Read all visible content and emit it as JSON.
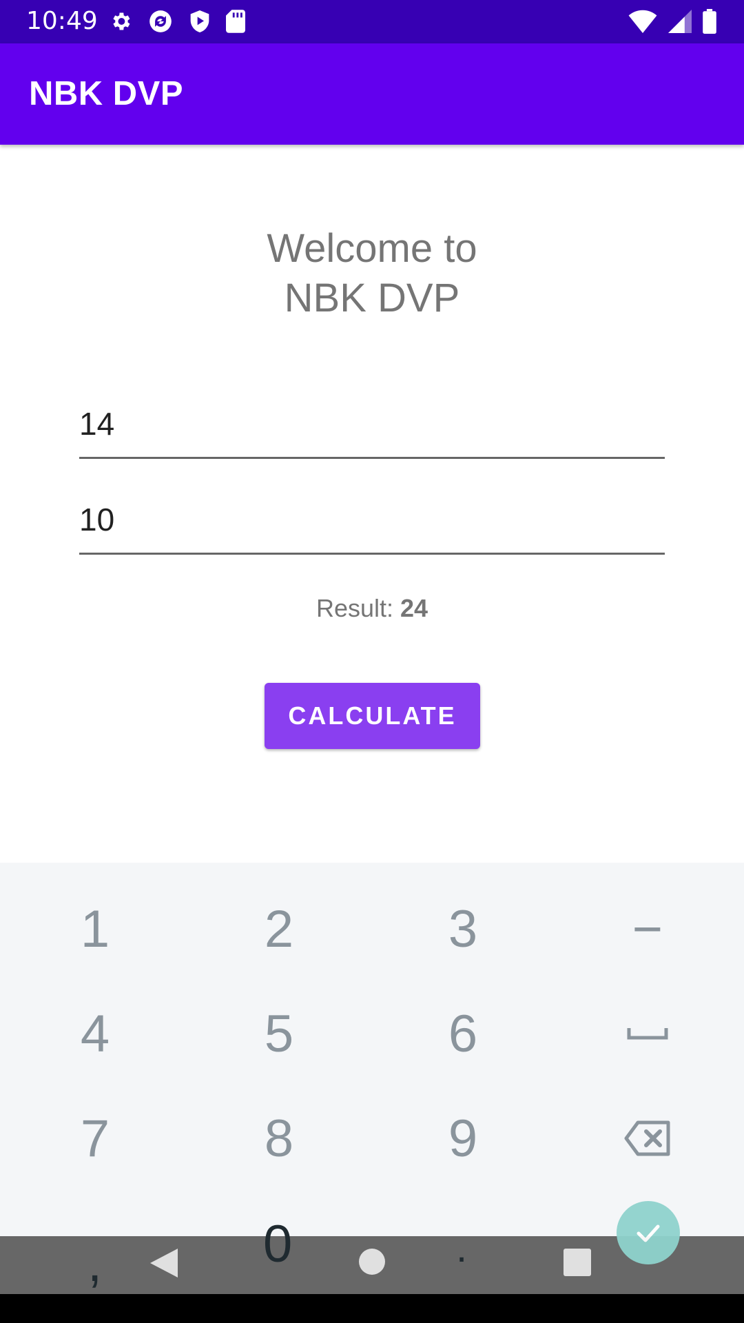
{
  "status_bar": {
    "time": "10:49",
    "left_icons": [
      "gear-icon",
      "sync-icon",
      "shield-play-icon",
      "sd-card-icon"
    ],
    "right_icons": [
      "wifi-icon",
      "signal-icon",
      "battery-icon"
    ]
  },
  "app_bar": {
    "title": "NBK DVP",
    "color": "#6200ee"
  },
  "main": {
    "welcome_line1": "Welcome to",
    "welcome_line2": "NBK DVP",
    "input1_value": "14",
    "input2_value": "10",
    "result_label": "Result: ",
    "result_value": "24",
    "calculate_label": "CALCULATE",
    "button_color": "#8a3ff0"
  },
  "keypad": {
    "keys": [
      "1",
      "2",
      "3",
      "−",
      "4",
      "5",
      "6",
      "␣",
      "7",
      "8",
      "9",
      "backspace",
      ",",
      "0",
      ".",
      "done"
    ]
  },
  "nav_bar": {
    "buttons": [
      "back-icon",
      "home-icon",
      "recents-icon"
    ]
  }
}
